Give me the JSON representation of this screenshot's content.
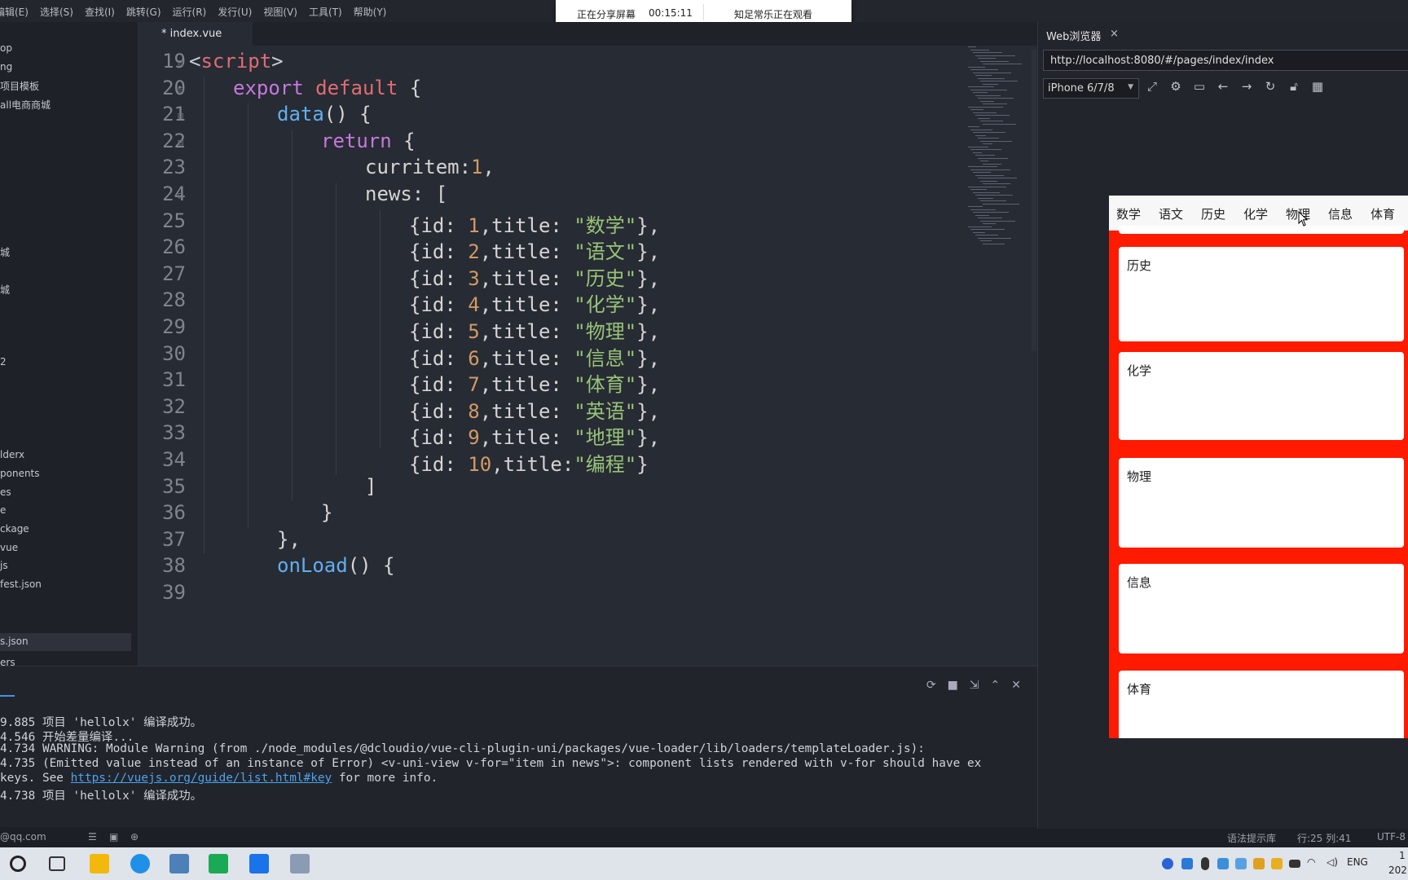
{
  "menu": [
    "编辑(E)",
    "选择(S)",
    "查找(I)",
    "跳转(G)",
    "运行(R)",
    "发行(U)",
    "视图(V)",
    "工具(T)",
    "帮助(Y)"
  ],
  "share": {
    "status": "正在分享屏幕",
    "timer": "00:15:11",
    "viewer": "知足常乐正在观看"
  },
  "sidebar": [
    "op",
    "ng",
    "项目模板",
    "all电商商城",
    "城",
    "城",
    "2",
    "lderx",
    "ponents",
    "es",
    "e",
    "ckage",
    "vue",
    "js",
    "fest.json",
    "s.json",
    "ers"
  ],
  "editor": {
    "tab": "* index.vue",
    "lines": [
      {
        "n": "19",
        "src": "<script>"
      },
      {
        "n": "20",
        "src": "export default {"
      },
      {
        "n": "21",
        "src": "data() {"
      },
      {
        "n": "22",
        "src": "return {"
      },
      {
        "n": "23",
        "src": "curritem:1,"
      },
      {
        "n": "24",
        "src": "news: ["
      },
      {
        "n": "25",
        "src": "{id: 1,title: \"数学\"},"
      },
      {
        "n": "26",
        "src": "{id: 2,title: \"语文\"},"
      },
      {
        "n": "27",
        "src": "{id: 3,title: \"历史\"},"
      },
      {
        "n": "28",
        "src": "{id: 4,title: \"化学\"},"
      },
      {
        "n": "29",
        "src": "{id: 5,title: \"物理\"},"
      },
      {
        "n": "30",
        "src": "{id: 6,title: \"信息\"},"
      },
      {
        "n": "31",
        "src": "{id: 7,title: \"体育\"},"
      },
      {
        "n": "32",
        "src": "{id: 8,title: \"英语\"},"
      },
      {
        "n": "33",
        "src": "{id: 9,title: \"地理\"},"
      },
      {
        "n": "34",
        "src": "{id: 10,title:\"编程\"}"
      },
      {
        "n": "35",
        "src": "]"
      },
      {
        "n": "36",
        "src": "}"
      },
      {
        "n": "37",
        "src": "},"
      },
      {
        "n": "38",
        "src": "onLoad() {"
      },
      {
        "n": "39",
        "src": ""
      }
    ]
  },
  "console": {
    "lines": [
      "9.885 项目 'hellolx' 编译成功。",
      "4.546 开始差量编译...",
      "4.734 WARNING: Module Warning (from ./node_modules/@dcloudio/vue-cli-plugin-uni/packages/vue-loader/lib/loaders/templateLoader.js):",
      "4.735 (Emitted value instead of an instance of Error) <v-uni-view v-for=\"item in news\">: component lists rendered with v-for should have ex",
      "keys. See ",
      "4.738 项目 'hellolx' 编译成功。"
    ],
    "link": "https://vuejs.org/guide/list.html#key",
    "link_suffix": " for more info."
  },
  "status": {
    "email": "@qq.com",
    "hint": "语法提示库",
    "pos": "行:25  列:41",
    "encoding": "UTF-8"
  },
  "browser": {
    "title": "Web浏览器",
    "close": "×",
    "url": "http://localhost:8080/#/pages/index/index",
    "device": "iPhone 6/7/8",
    "tabs": [
      "数学",
      "语文",
      "历史",
      "化学",
      "物理",
      "信息",
      "体育"
    ],
    "cards": [
      "历史",
      "化学",
      "物理",
      "信息",
      "体育"
    ]
  },
  "taskbar": {
    "lang": "ENG",
    "time": "1",
    "year": "202"
  }
}
